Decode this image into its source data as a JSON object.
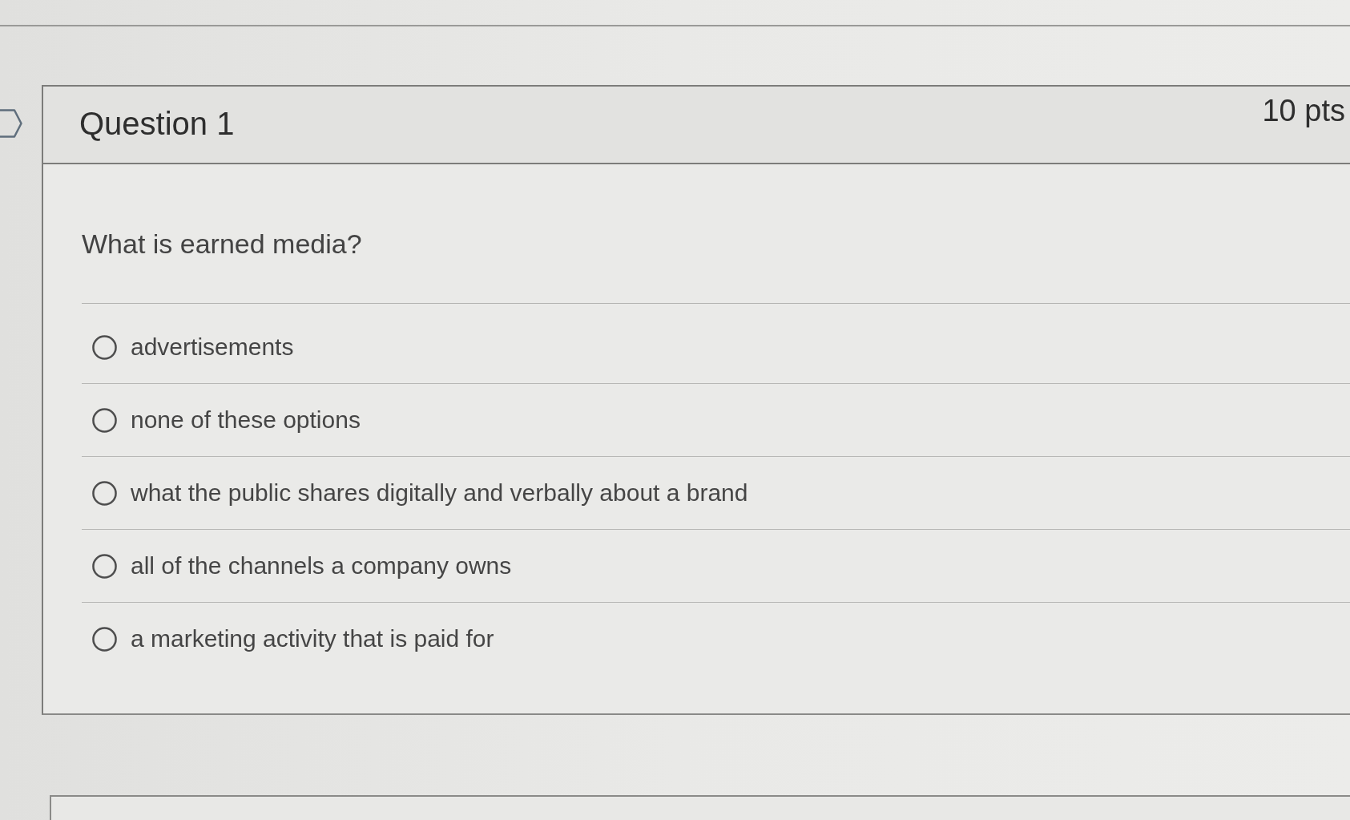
{
  "question": {
    "title": "Question 1",
    "points": "10 pts",
    "prompt": "What is earned media?",
    "answers": [
      {
        "label": "advertisements",
        "selected": false
      },
      {
        "label": "none of these options",
        "selected": false
      },
      {
        "label": "what the public shares digitally and verbally about a brand",
        "selected": false
      },
      {
        "label": "all of the channels a company owns",
        "selected": false
      },
      {
        "label": "a marketing activity that is paid for",
        "selected": false
      }
    ]
  }
}
